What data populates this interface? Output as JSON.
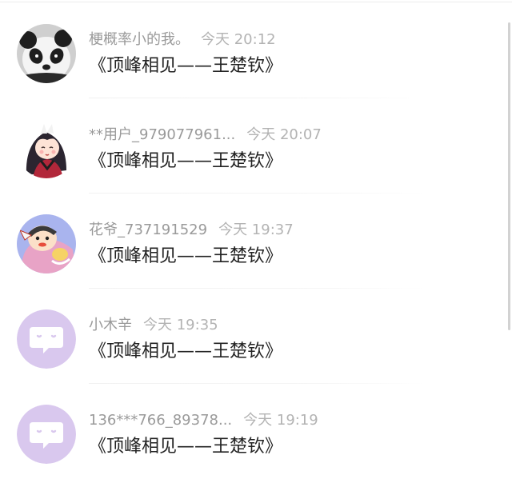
{
  "comments": [
    {
      "username": "梗概率小的我。",
      "time": "今天 20:12",
      "content": "《顶峰相见——王楚钦》",
      "avatar_icon": "panda-avatar-icon"
    },
    {
      "username": "**用户_979077961...",
      "time": "今天 20:07",
      "content": "《顶峰相见——王楚钦》",
      "avatar_icon": "anime-character-avatar-icon"
    },
    {
      "username": "花爷_737191529",
      "time": "今天 19:37",
      "content": "《顶峰相见——王楚钦》",
      "avatar_icon": "cartoon-character-avatar-icon"
    },
    {
      "username": "小木辛",
      "time": "今天 19:35",
      "content": "《顶峰相见——王楚钦》",
      "avatar_icon": "default-chat-bubble-avatar-icon"
    },
    {
      "username": "136***766_89378...",
      "time": "今天 19:19",
      "content": "《顶峰相见——王楚钦》",
      "avatar_icon": "default-chat-bubble-avatar-icon"
    }
  ],
  "colors": {
    "username": "#9a9a9a",
    "time": "#b3b3b3",
    "content": "#222222",
    "default_avatar": "#d9c8ee"
  }
}
